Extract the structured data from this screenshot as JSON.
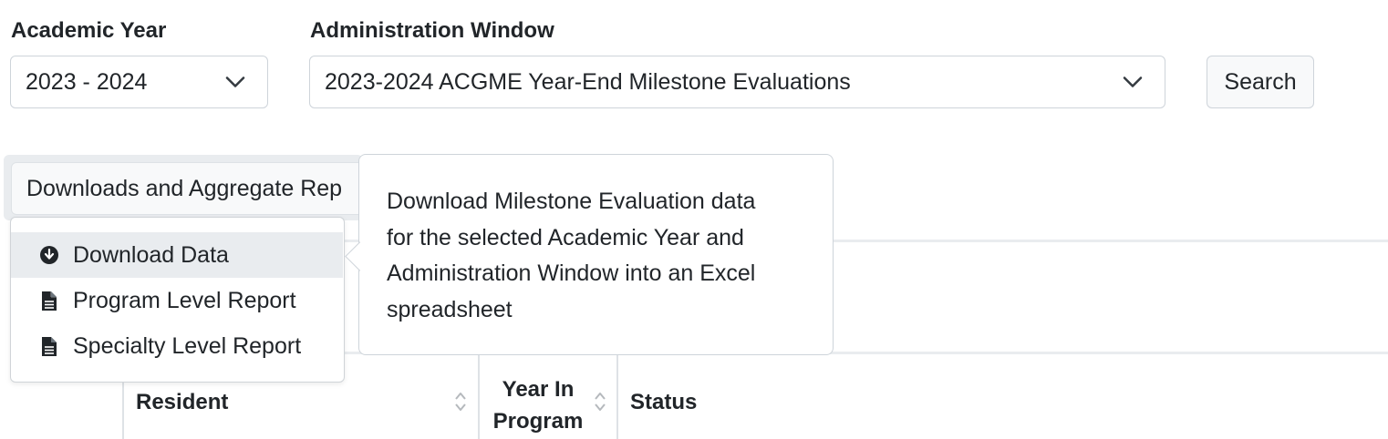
{
  "filters": {
    "academic_year": {
      "label": "Academic Year",
      "value": "2023 - 2024"
    },
    "admin_window": {
      "label": "Administration Window",
      "value": "2023-2024 ACGME Year-End Milestone Evaluations"
    },
    "search_label": "Search"
  },
  "downloads": {
    "toggle_label": "Downloads and Aggregate Rep",
    "items": [
      {
        "label": "Download Data",
        "icon": "download-circle-icon",
        "active": true
      },
      {
        "label": "Program Level Report",
        "icon": "document-icon"
      },
      {
        "label": "Specialty Level Report",
        "icon": "document-icon"
      }
    ],
    "tooltip_lines": [
      "Download Milestone Evaluation data",
      "for the selected Academic Year and",
      "Administration Window into an Excel",
      "spreadsheet"
    ]
  },
  "table": {
    "headers": {
      "resident": "Resident",
      "year_line1": "Year In",
      "year_line2": "Program",
      "status": "Status"
    }
  },
  "colors": {
    "active_item_bg": "#e9ecef",
    "border": "#ced4da"
  }
}
